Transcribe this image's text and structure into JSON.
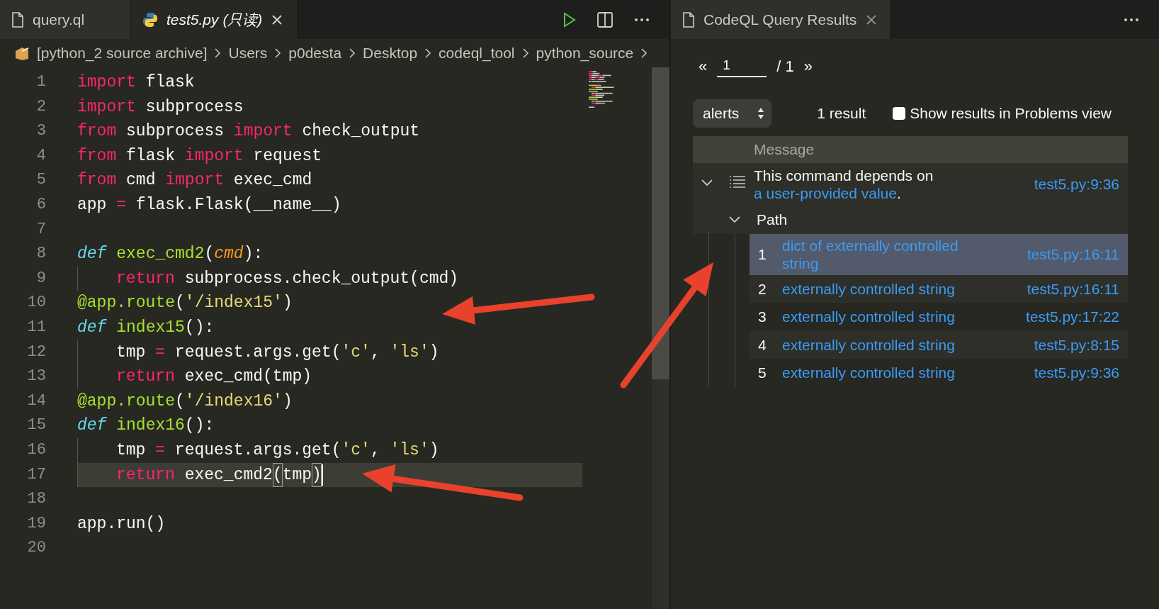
{
  "editor": {
    "tabs": [
      {
        "label": "query.ql",
        "selected": false
      },
      {
        "label": "test5.py (只读)",
        "selected": true
      }
    ],
    "breadcrumbs": [
      "[python_2 source archive]",
      "Users",
      "p0desta",
      "Desktop",
      "codeql_tool",
      "python_source"
    ],
    "lines": [
      {
        "number": "1",
        "indent": false,
        "current": false,
        "tokens": [
          {
            "kind": "k",
            "text": "import"
          },
          {
            "kind": "t",
            "text": " flask"
          }
        ]
      },
      {
        "number": "2",
        "indent": false,
        "current": false,
        "tokens": [
          {
            "kind": "k",
            "text": "import"
          },
          {
            "kind": "t",
            "text": " subprocess"
          }
        ]
      },
      {
        "number": "3",
        "indent": false,
        "current": false,
        "tokens": [
          {
            "kind": "k",
            "text": "from"
          },
          {
            "kind": "t",
            "text": " subprocess "
          },
          {
            "kind": "k",
            "text": "import"
          },
          {
            "kind": "t",
            "text": " check_output"
          }
        ]
      },
      {
        "number": "4",
        "indent": false,
        "current": false,
        "tokens": [
          {
            "kind": "k",
            "text": "from"
          },
          {
            "kind": "t",
            "text": " flask "
          },
          {
            "kind": "k",
            "text": "import"
          },
          {
            "kind": "t",
            "text": " request"
          }
        ]
      },
      {
        "number": "5",
        "indent": false,
        "current": false,
        "tokens": [
          {
            "kind": "k",
            "text": "from"
          },
          {
            "kind": "t",
            "text": " cmd "
          },
          {
            "kind": "k",
            "text": "import"
          },
          {
            "kind": "t",
            "text": " exec_cmd"
          }
        ]
      },
      {
        "number": "6",
        "indent": false,
        "current": false,
        "tokens": [
          {
            "kind": "t",
            "text": "app "
          },
          {
            "kind": "k",
            "text": "="
          },
          {
            "kind": "t",
            "text": " flask.Flask(__name__)"
          }
        ]
      },
      {
        "number": "7"
      },
      {
        "number": "8",
        "indent": false,
        "current": false,
        "tokens": [
          {
            "kind": "d",
            "text": "def"
          },
          {
            "kind": "f",
            "text": " exec_cmd2"
          },
          {
            "kind": "t",
            "text": "("
          },
          {
            "kind": "p",
            "text": "cmd"
          },
          {
            "kind": "t",
            "text": "):"
          }
        ]
      },
      {
        "number": "9",
        "indent": true,
        "current": false,
        "tokens": [
          {
            "kind": "k",
            "text": "return"
          },
          {
            "kind": "t",
            "text": " subprocess.check_output(cmd)"
          }
        ]
      },
      {
        "number": "10",
        "indent": false,
        "current": false,
        "tokens": [
          {
            "kind": "f",
            "text": "@app.route"
          },
          {
            "kind": "t",
            "text": "("
          },
          {
            "kind": "s",
            "text": "'/index15'"
          },
          {
            "kind": "t",
            "text": ")"
          }
        ]
      },
      {
        "number": "11",
        "indent": false,
        "current": false,
        "tokens": [
          {
            "kind": "d",
            "text": "def"
          },
          {
            "kind": "f",
            "text": " index15"
          },
          {
            "kind": "t",
            "text": "():"
          }
        ]
      },
      {
        "number": "12",
        "indent": true,
        "current": false,
        "tokens": [
          {
            "kind": "t",
            "text": "tmp "
          },
          {
            "kind": "k",
            "text": "="
          },
          {
            "kind": "t",
            "text": " request.args.get("
          },
          {
            "kind": "s",
            "text": "'c'"
          },
          {
            "kind": "t",
            "text": ", "
          },
          {
            "kind": "s",
            "text": "'ls'"
          },
          {
            "kind": "t",
            "text": ")"
          }
        ]
      },
      {
        "number": "13",
        "indent": true,
        "current": false,
        "tokens": [
          {
            "kind": "k",
            "text": "return"
          },
          {
            "kind": "t",
            "text": " exec_cmd(tmp)"
          }
        ]
      },
      {
        "number": "14",
        "indent": false,
        "current": false,
        "tokens": [
          {
            "kind": "f",
            "text": "@app.route"
          },
          {
            "kind": "t",
            "text": "("
          },
          {
            "kind": "s",
            "text": "'/index16'"
          },
          {
            "kind": "t",
            "text": ")"
          }
        ]
      },
      {
        "number": "15",
        "indent": false,
        "current": false,
        "tokens": [
          {
            "kind": "d",
            "text": "def"
          },
          {
            "kind": "f",
            "text": " index16"
          },
          {
            "kind": "t",
            "text": "():"
          }
        ]
      },
      {
        "number": "16",
        "indent": true,
        "current": false,
        "tokens": [
          {
            "kind": "t",
            "text": "tmp "
          },
          {
            "kind": "k",
            "text": "="
          },
          {
            "kind": "t",
            "text": " request.args.get("
          },
          {
            "kind": "s",
            "text": "'c'"
          },
          {
            "kind": "t",
            "text": ", "
          },
          {
            "kind": "s",
            "text": "'ls'"
          },
          {
            "kind": "t",
            "text": ")"
          }
        ]
      },
      {
        "number": "17",
        "indent": true,
        "current": true,
        "tokens": [
          {
            "kind": "k",
            "text": "return"
          },
          {
            "kind": "t",
            "text": " exec_cmd2"
          },
          {
            "kind": "b",
            "text": "("
          },
          {
            "kind": "t",
            "text": "tmp"
          },
          {
            "kind": "b",
            "text": ")"
          }
        ]
      },
      {
        "number": "18"
      },
      {
        "number": "19",
        "indent": false,
        "current": false,
        "tokens": [
          {
            "kind": "t",
            "text": "app.run()"
          }
        ]
      },
      {
        "number": "20"
      }
    ]
  },
  "results": {
    "tab": {
      "label": "CodeQL Query Results",
      "selected": false
    },
    "pager": {
      "first": "«",
      "page": "1",
      "total": "/ 1",
      "last": "»"
    },
    "result_set": "alerts",
    "count": "1 result",
    "problems_view": {
      "label": "Show results in Problems view",
      "checked": false
    },
    "table": {
      "header": "Message",
      "alert": {
        "expanded": true,
        "text": "This command depends on ",
        "link": "a user-provided value",
        "after": ".",
        "location": "test5.py:9:36"
      },
      "path": {
        "label": "Path",
        "expanded": true
      },
      "steps": [
        {
          "number": "1",
          "text": "dict of externally controlled string",
          "location": "test5.py:16:11",
          "selected": true
        },
        {
          "number": "2",
          "text": "externally controlled string",
          "location": "test5.py:16:11",
          "selected": false
        },
        {
          "number": "3",
          "text": "externally controlled string",
          "location": "test5.py:17:22",
          "selected": false
        },
        {
          "number": "4",
          "text": "externally controlled string",
          "location": "test5.py:8:15",
          "selected": false
        },
        {
          "number": "5",
          "text": "externally controlled string",
          "location": "test5.py:9:36",
          "selected": false
        }
      ]
    }
  }
}
